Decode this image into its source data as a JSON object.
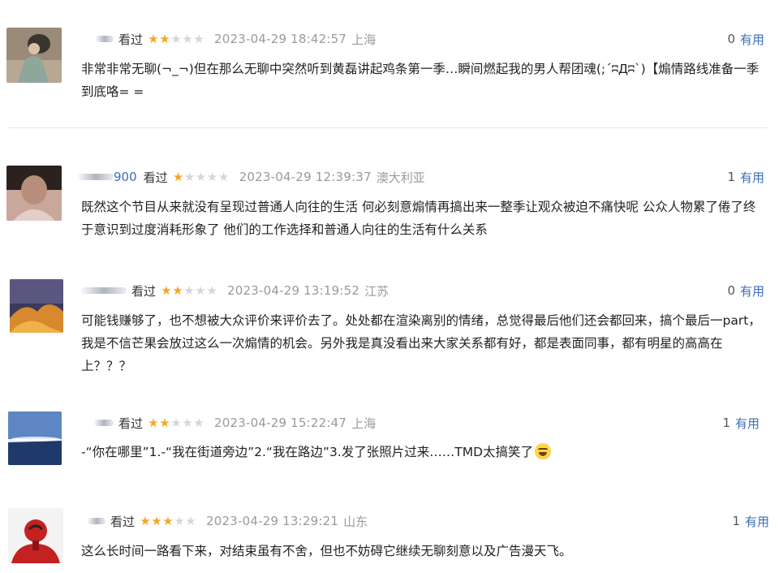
{
  "comments": [
    {
      "username": "",
      "watched": "看过",
      "rating": 2,
      "time": "2023-04-29 18:42:57",
      "location": "上海",
      "useful_count": "0",
      "useful_label": "有用",
      "text": "非常非常无聊(¬_¬)但在那么无聊中突然听到黄磊讲起鸡条第一季…瞬间燃起我的男人帮团魂(;´ʭДʭ`)【煽情路线准备一季到底咯= ="
    },
    {
      "username": "900",
      "watched": "看过",
      "rating": 1,
      "time": "2023-04-29 12:39:37",
      "location": "澳大利亚",
      "useful_count": "1",
      "useful_label": "有用",
      "text": "既然这个节目从来就没有呈现过普通人向往的生活 何必刻意煽情再搞出来一整季让观众被迫不痛快呢 公众人物累了倦了终于意识到过度消耗形象了 他们的工作选择和普通人向往的生活有什么关系"
    },
    {
      "username": "",
      "watched": "看过",
      "rating": 2,
      "time": "2023-04-29 13:19:52",
      "location": "江苏",
      "useful_count": "0",
      "useful_label": "有用",
      "text": "可能钱赚够了，也不想被大众评价来评价去了。处处都在渲染离别的情绪，总觉得最后他们还会都回来，搞个最后一part，我是不信芒果会放过这么一次煽情的机会。另外我是真没看出来大家关系都有好，都是表面同事，都有明星的高高在上？？？"
    },
    {
      "username": "",
      "watched": "看过",
      "rating": 2,
      "time": "2023-04-29 15:22:47",
      "location": "上海",
      "useful_count": "1",
      "useful_label": "有用",
      "text": "-“你在哪里”1.-“我在街道旁边”2.“我在路边”3.发了张照片过来……TMD太搞笑了"
    },
    {
      "username": "",
      "watched": "看过",
      "rating": 3,
      "time": "2023-04-29 13:29:21",
      "location": "山东",
      "useful_count": "1",
      "useful_label": "有用",
      "text": "这么长时间一路看下来，对结束虽有不舍，但也不妨碍它继续无聊刻意以及广告漫天飞。"
    }
  ],
  "colors": {
    "star_on": "#f5a623",
    "star_off": "#d6d6d6",
    "link": "#3d6fb3",
    "meta": "#9a9a9a"
  },
  "icons": {
    "star": "star-icon",
    "emoji": "laughing-face-emoji"
  }
}
